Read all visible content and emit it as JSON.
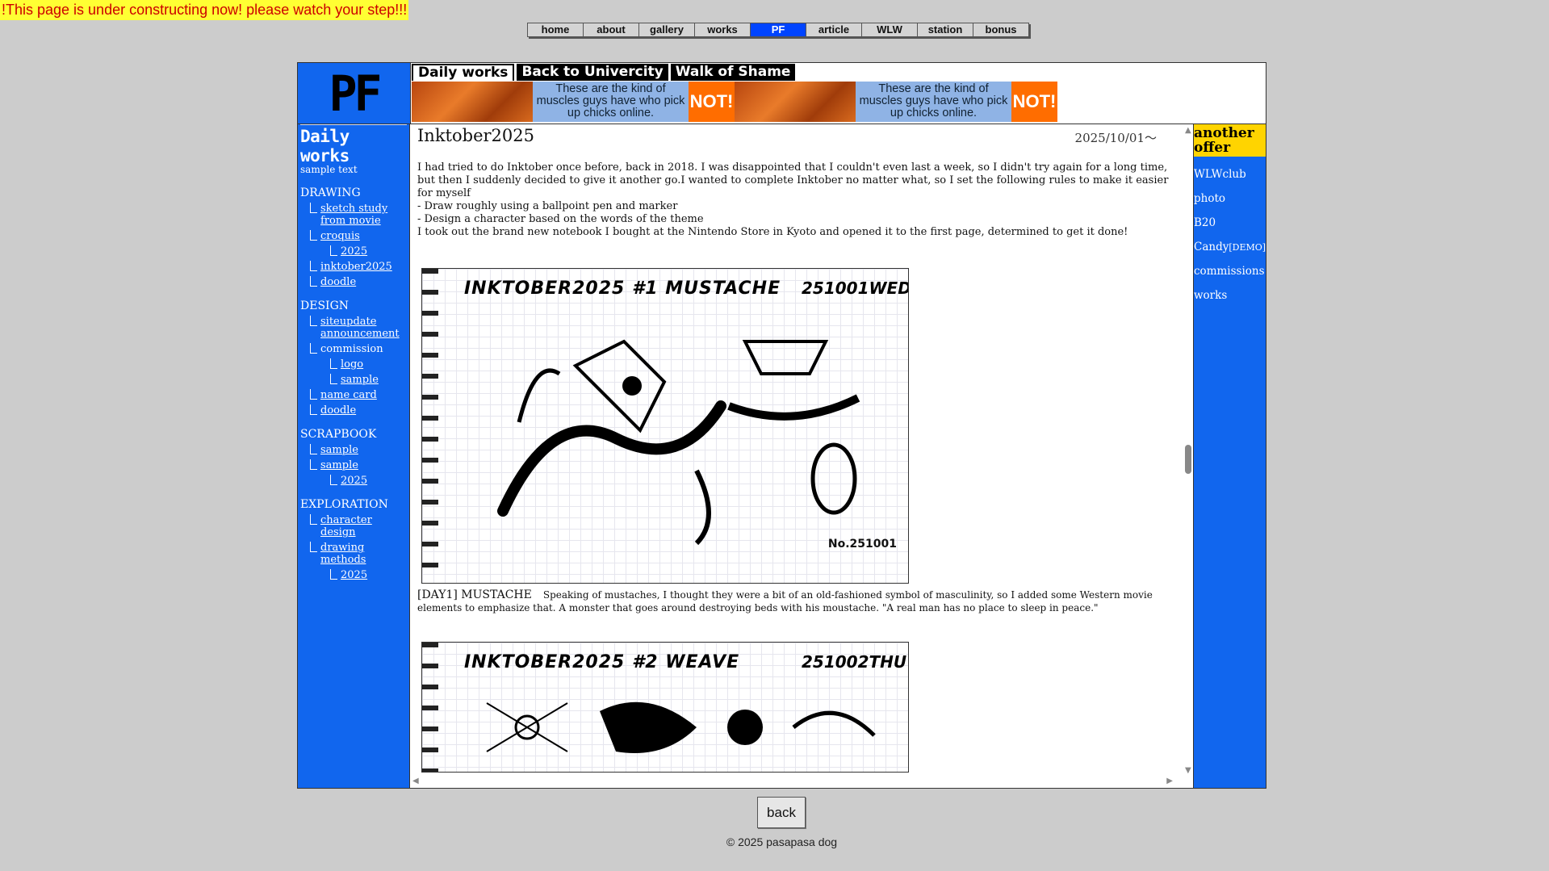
{
  "warning": "!This page is under constructing now! please watch your step!!!",
  "topnav": [
    "home",
    "about",
    "gallery",
    "works",
    "PF",
    "article",
    "WLW",
    "station",
    "bonus"
  ],
  "topnav_active": "PF",
  "logo": "PF",
  "tabs": [
    "Daily works",
    "Back to Univercity",
    "Walk of Shame"
  ],
  "banner": {
    "text": "These are the kind of muscles guys have who pick up chicks online.",
    "badge": "NOT!"
  },
  "sidebar": {
    "title": "Daily works",
    "subtitle": "sample text",
    "sections": [
      {
        "name": "DRAWING",
        "items": [
          {
            "label": "sketch study from movie",
            "level": 1,
            "link": true
          },
          {
            "label": "croquis",
            "level": 1,
            "link": true
          },
          {
            "label": "2025",
            "level": 2,
            "link": true
          },
          {
            "label": "inktober2025",
            "level": 1,
            "link": true
          },
          {
            "label": "doodle",
            "level": 1,
            "link": true
          }
        ]
      },
      {
        "name": "DESIGN",
        "items": [
          {
            "label": "siteupdate announcement",
            "level": 1,
            "link": true
          },
          {
            "label": "commission",
            "level": 1,
            "link": false
          },
          {
            "label": "logo",
            "level": 2,
            "link": true
          },
          {
            "label": "sample",
            "level": 2,
            "link": true
          },
          {
            "label": "name card",
            "level": 1,
            "link": true
          },
          {
            "label": "doodle",
            "level": 1,
            "link": true
          }
        ]
      },
      {
        "name": "SCRAPBOOK",
        "items": [
          {
            "label": "sample",
            "level": 1,
            "link": true
          },
          {
            "label": "sample",
            "level": 1,
            "link": true
          },
          {
            "label": "2025",
            "level": 2,
            "link": true
          }
        ]
      },
      {
        "name": "EXPLORATION",
        "items": [
          {
            "label": "character design",
            "level": 1,
            "link": true
          },
          {
            "label": "drawing methods",
            "level": 1,
            "link": true
          },
          {
            "label": "2025",
            "level": 2,
            "link": true
          }
        ]
      }
    ]
  },
  "post": {
    "title": "Inktober2025",
    "date": "2025/10/01〜",
    "body": [
      "I had tried to do Inktober once before, back in 2018. I was disappointed that I couldn't even last a week, so I didn't try again for a long time, but then I suddenly decided to give it another go.I wanted to complete Inktober no matter what, so I set the following rules to make it easier for myself",
      "- Draw roughly using a ballpoint pen and marker",
      "- Design a character based on the words of the theme",
      "I took out the brand new notebook I bought at the Nintendo Store in Kyoto and opened it to the first page, determined to get it done!"
    ],
    "sketch1": {
      "title": "INKTOBER2025 #1 MUSTACHE",
      "date": "251001WED",
      "num": "No.251001"
    },
    "caption1_head": "[DAY1] MUSTACHE",
    "caption1_text": "Speaking of mustaches, I thought they were a bit of an old-fashioned symbol of masculinity, so I added some Western movie elements to emphasize that. A monster that goes around destroying beds with his moustache. \"A real man has no place to sleep in peace.\"",
    "sketch2": {
      "title": "INKTOBER2025 #2 WEAVE",
      "date": "251002THU"
    }
  },
  "right": {
    "offer": "another offer",
    "items": [
      "WLWclub",
      "photo",
      "B20",
      "Candy",
      "commissions",
      "works"
    ],
    "candy_tag": "[DEMO]"
  },
  "back": "back",
  "copyright": "© 2025 pasapasa dog"
}
